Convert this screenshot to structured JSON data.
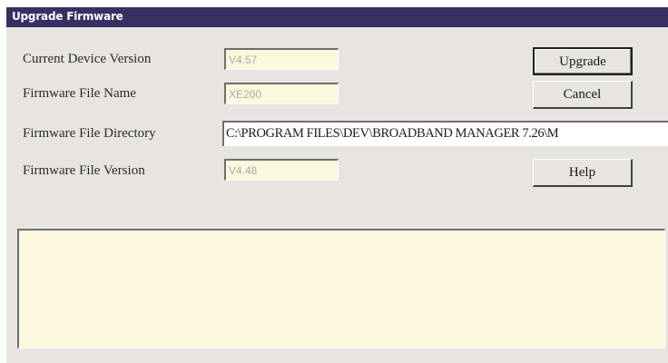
{
  "window": {
    "title": "Upgrade Firmware"
  },
  "form": {
    "current_version_label": "Current Device Version",
    "current_version_value": "V4.57",
    "file_name_label": "Firmware File Name",
    "file_name_value": "XE200",
    "file_directory_label": "Firmware File Directory",
    "file_directory_value": "C:\\PROGRAM FILES\\DEV\\BROADBAND MANAGER 7.26\\M",
    "file_version_label": "Firmware File Version",
    "file_version_value": "V4.48"
  },
  "buttons": {
    "upgrade_label": "Upgrade",
    "cancel_label": "Cancel",
    "help_label": "Help"
  },
  "log": {
    "text": ""
  },
  "colors": {
    "titlebar": "#3a2f63",
    "dialog_background": "#e8e5e1",
    "readonly_field": "#fcf8de"
  }
}
